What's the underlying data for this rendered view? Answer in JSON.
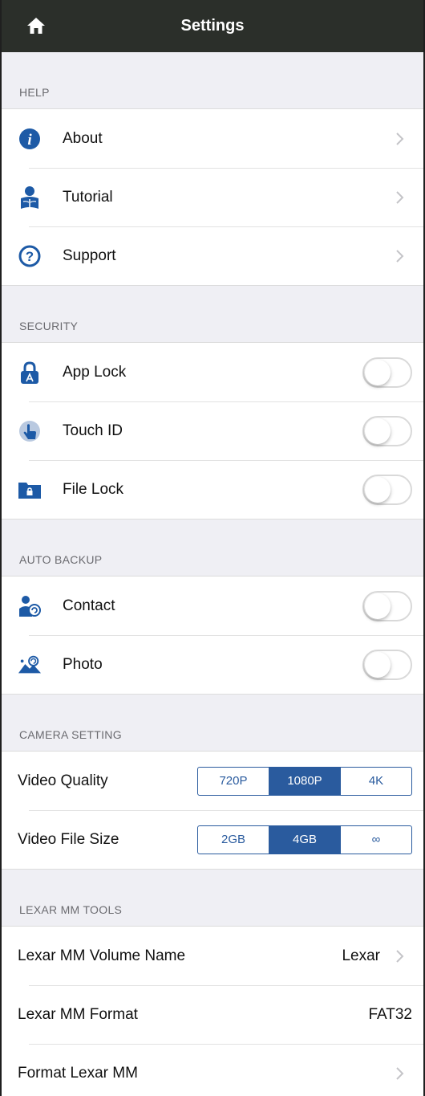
{
  "nav": {
    "title": "Settings"
  },
  "help": {
    "header": "HELP",
    "items": [
      {
        "label": "About"
      },
      {
        "label": "Tutorial"
      },
      {
        "label": "Support"
      }
    ]
  },
  "security": {
    "header": "SECURITY",
    "items": [
      {
        "label": "App Lock",
        "on": false
      },
      {
        "label": "Touch ID",
        "on": false
      },
      {
        "label": "File Lock",
        "on": false
      }
    ]
  },
  "backup": {
    "header": "AUTO BACKUP",
    "items": [
      {
        "label": "Contact",
        "on": false
      },
      {
        "label": "Photo",
        "on": false
      }
    ]
  },
  "camera": {
    "header": "CAMERA SETTING",
    "video_quality": {
      "label": "Video Quality",
      "options": [
        "720P",
        "1080P",
        "4K"
      ],
      "selected": "1080P"
    },
    "video_file_size": {
      "label": "Video File Size",
      "options": [
        "2GB",
        "4GB",
        "∞"
      ],
      "selected": "4GB"
    }
  },
  "tools": {
    "header": "LEXAR MM TOOLS",
    "volume": {
      "label": "Lexar MM Volume Name",
      "value": "Lexar"
    },
    "format_info": {
      "label": "Lexar MM Format",
      "value": "FAT32"
    },
    "format_action": {
      "label": "Format Lexar MM"
    }
  },
  "colors": {
    "accent": "#2a5b9e",
    "nav_bg": "#2b2f2a",
    "icon_blue": "#1d5aa6"
  }
}
